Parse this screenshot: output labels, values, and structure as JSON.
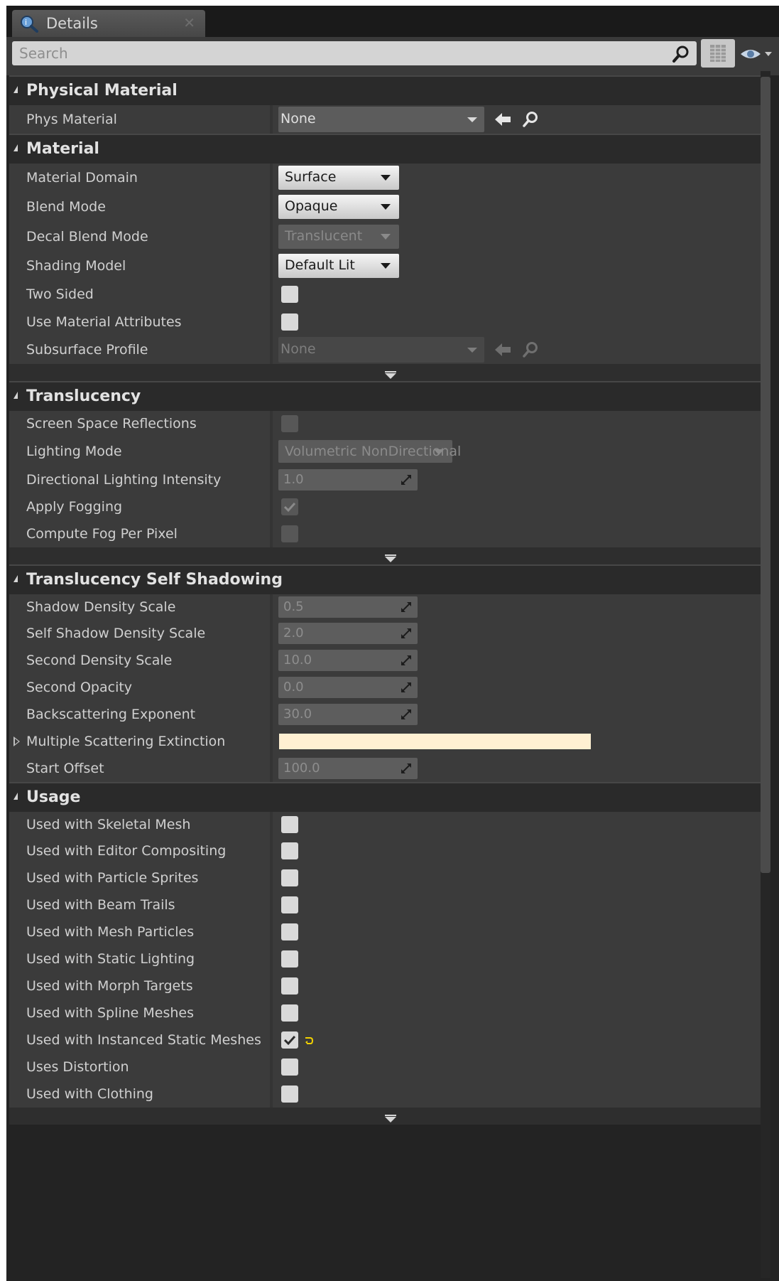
{
  "colors": {
    "panel_bg": "#232323",
    "row_bg": "#3b3b3b",
    "header_bg": "#2a2a2a",
    "search_bg": "#d4d4d4",
    "swatch": "#fff0d2",
    "checkbox": "#d9d9d9"
  },
  "tab": {
    "title": "Details",
    "icon": "details-magnifier-icon",
    "close": "✕"
  },
  "search": {
    "placeholder": "Search",
    "value": ""
  },
  "toolbar": {
    "view_options_icon": "grid-view-icon",
    "visibility_icon": "eye-dropdown-icon"
  },
  "sections": [
    {
      "title": "Physical Material",
      "rows": [
        {
          "label": "Phys Material",
          "type": "asset",
          "value": "None",
          "disabled": false
        }
      ]
    },
    {
      "title": "Material",
      "rows": [
        {
          "label": "Material Domain",
          "type": "combo",
          "value": "Surface",
          "disabled": false
        },
        {
          "label": "Blend Mode",
          "type": "combo",
          "value": "Opaque",
          "disabled": false
        },
        {
          "label": "Decal Blend Mode",
          "type": "combo",
          "value": "Translucent",
          "disabled": true
        },
        {
          "label": "Shading Model",
          "type": "combo",
          "value": "Default Lit",
          "disabled": false
        },
        {
          "label": "Two Sided",
          "type": "checkbox",
          "checked": false,
          "disabled": false
        },
        {
          "label": "Use Material Attributes",
          "type": "checkbox",
          "checked": false,
          "disabled": false
        },
        {
          "label": "Subsurface Profile",
          "type": "asset",
          "value": "None",
          "disabled": true
        }
      ],
      "advanced": true
    },
    {
      "title": "Translucency",
      "rows": [
        {
          "label": "Screen Space Reflections",
          "type": "checkbox",
          "checked": false,
          "disabled": true
        },
        {
          "label": "Lighting Mode",
          "type": "combo",
          "value": "Volumetric NonDirectional",
          "disabled": true,
          "wide": true
        },
        {
          "label": "Directional Lighting Intensity",
          "type": "number",
          "value": "1.0",
          "disabled": true
        },
        {
          "label": "Apply Fogging",
          "type": "checkbox",
          "checked": true,
          "disabled": true
        },
        {
          "label": "Compute Fog Per Pixel",
          "type": "checkbox",
          "checked": false,
          "disabled": true
        }
      ],
      "advanced": true
    },
    {
      "title": "Translucency Self Shadowing",
      "rows": [
        {
          "label": "Shadow Density Scale",
          "type": "number",
          "value": "0.5",
          "disabled": true
        },
        {
          "label": "Self Shadow Density Scale",
          "type": "number",
          "value": "2.0",
          "disabled": true
        },
        {
          "label": "Second Density Scale",
          "type": "number",
          "value": "10.0",
          "disabled": true
        },
        {
          "label": "Second Opacity",
          "type": "number",
          "value": "0.0",
          "disabled": true
        },
        {
          "label": "Backscattering Exponent",
          "type": "number",
          "value": "30.0",
          "disabled": true
        },
        {
          "label": "Multiple Scattering Extinction",
          "type": "color",
          "value": "#fff0d2",
          "expandable": true,
          "disabled": false
        },
        {
          "label": "Start Offset",
          "type": "number",
          "value": "100.0",
          "disabled": true
        }
      ]
    },
    {
      "title": "Usage",
      "rows": [
        {
          "label": "Used with Skeletal Mesh",
          "type": "checkbox",
          "checked": false,
          "disabled": false
        },
        {
          "label": "Used with Editor Compositing",
          "type": "checkbox",
          "checked": false,
          "disabled": false
        },
        {
          "label": "Used with Particle Sprites",
          "type": "checkbox",
          "checked": false,
          "disabled": false
        },
        {
          "label": "Used with Beam Trails",
          "type": "checkbox",
          "checked": false,
          "disabled": false
        },
        {
          "label": "Used with Mesh Particles",
          "type": "checkbox",
          "checked": false,
          "disabled": false
        },
        {
          "label": "Used with Static Lighting",
          "type": "checkbox",
          "checked": false,
          "disabled": false
        },
        {
          "label": "Used with Morph Targets",
          "type": "checkbox",
          "checked": false,
          "disabled": false
        },
        {
          "label": "Used with Spline Meshes",
          "type": "checkbox",
          "checked": false,
          "disabled": false
        },
        {
          "label": "Used with Instanced Static Meshes",
          "type": "checkbox",
          "checked": true,
          "disabled": false,
          "reset": true
        },
        {
          "label": "Uses Distortion",
          "type": "checkbox",
          "checked": false,
          "disabled": false
        },
        {
          "label": "Used with Clothing",
          "type": "checkbox",
          "checked": false,
          "disabled": false
        }
      ],
      "advanced": true
    }
  ]
}
